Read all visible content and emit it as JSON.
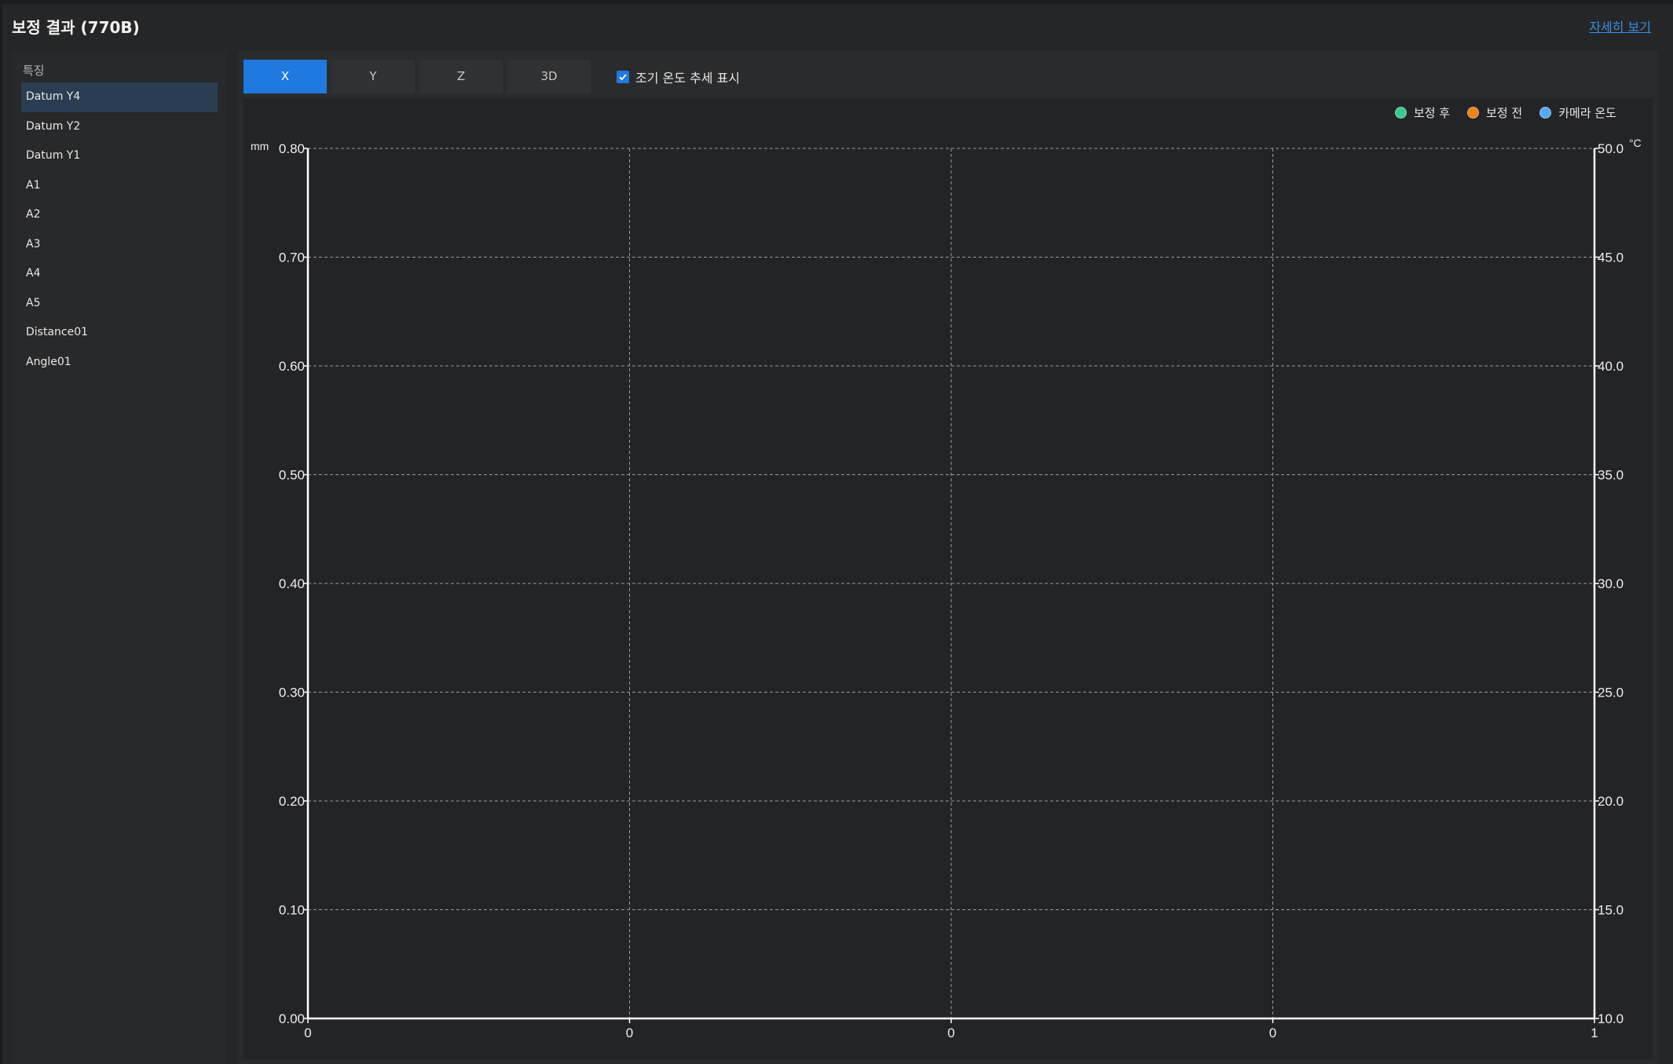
{
  "header": {
    "title": "보정 결과 (770B)",
    "detail_link": "자세히 보기"
  },
  "sidebar": {
    "heading": "특징",
    "items": [
      {
        "label": "Datum Y4",
        "active": true
      },
      {
        "label": "Datum Y2"
      },
      {
        "label": "Datum Y1"
      },
      {
        "label": "A1"
      },
      {
        "label": "A2"
      },
      {
        "label": "A3"
      },
      {
        "label": "A4"
      },
      {
        "label": "A5"
      },
      {
        "label": "Distance01"
      },
      {
        "label": "Angle01"
      }
    ]
  },
  "tabs": [
    {
      "label": "X",
      "active": true
    },
    {
      "label": "Y"
    },
    {
      "label": "Z"
    },
    {
      "label": "3D"
    }
  ],
  "checkbox": {
    "label": "조기 온도 추세 표시",
    "checked": true,
    "icon": "check-icon"
  },
  "legend": [
    {
      "label": "보정 후",
      "color": "#3cc88a"
    },
    {
      "label": "보정 전",
      "color": "#e8841e"
    },
    {
      "label": "카메라 온도",
      "color": "#5aa8f0"
    }
  ],
  "colors": {
    "accent": "#2079df",
    "link": "#3a8fe6"
  },
  "chart_data": {
    "type": "line",
    "series": [],
    "ylabel": "mm",
    "y2label": "°C",
    "ylim": [
      0,
      0.8
    ],
    "y2lim": [
      10,
      50
    ],
    "yticks": [
      "0.00",
      "0.10",
      "0.20",
      "0.30",
      "0.40",
      "0.50",
      "0.60",
      "0.70",
      "0.80"
    ],
    "y2ticks": [
      "10.0",
      "15.0",
      "20.0",
      "25.0",
      "30.0",
      "35.0",
      "40.0",
      "45.0",
      "50.0"
    ],
    "xticks": [
      "0",
      "0",
      "0",
      "0",
      "1"
    ],
    "grid": true
  }
}
